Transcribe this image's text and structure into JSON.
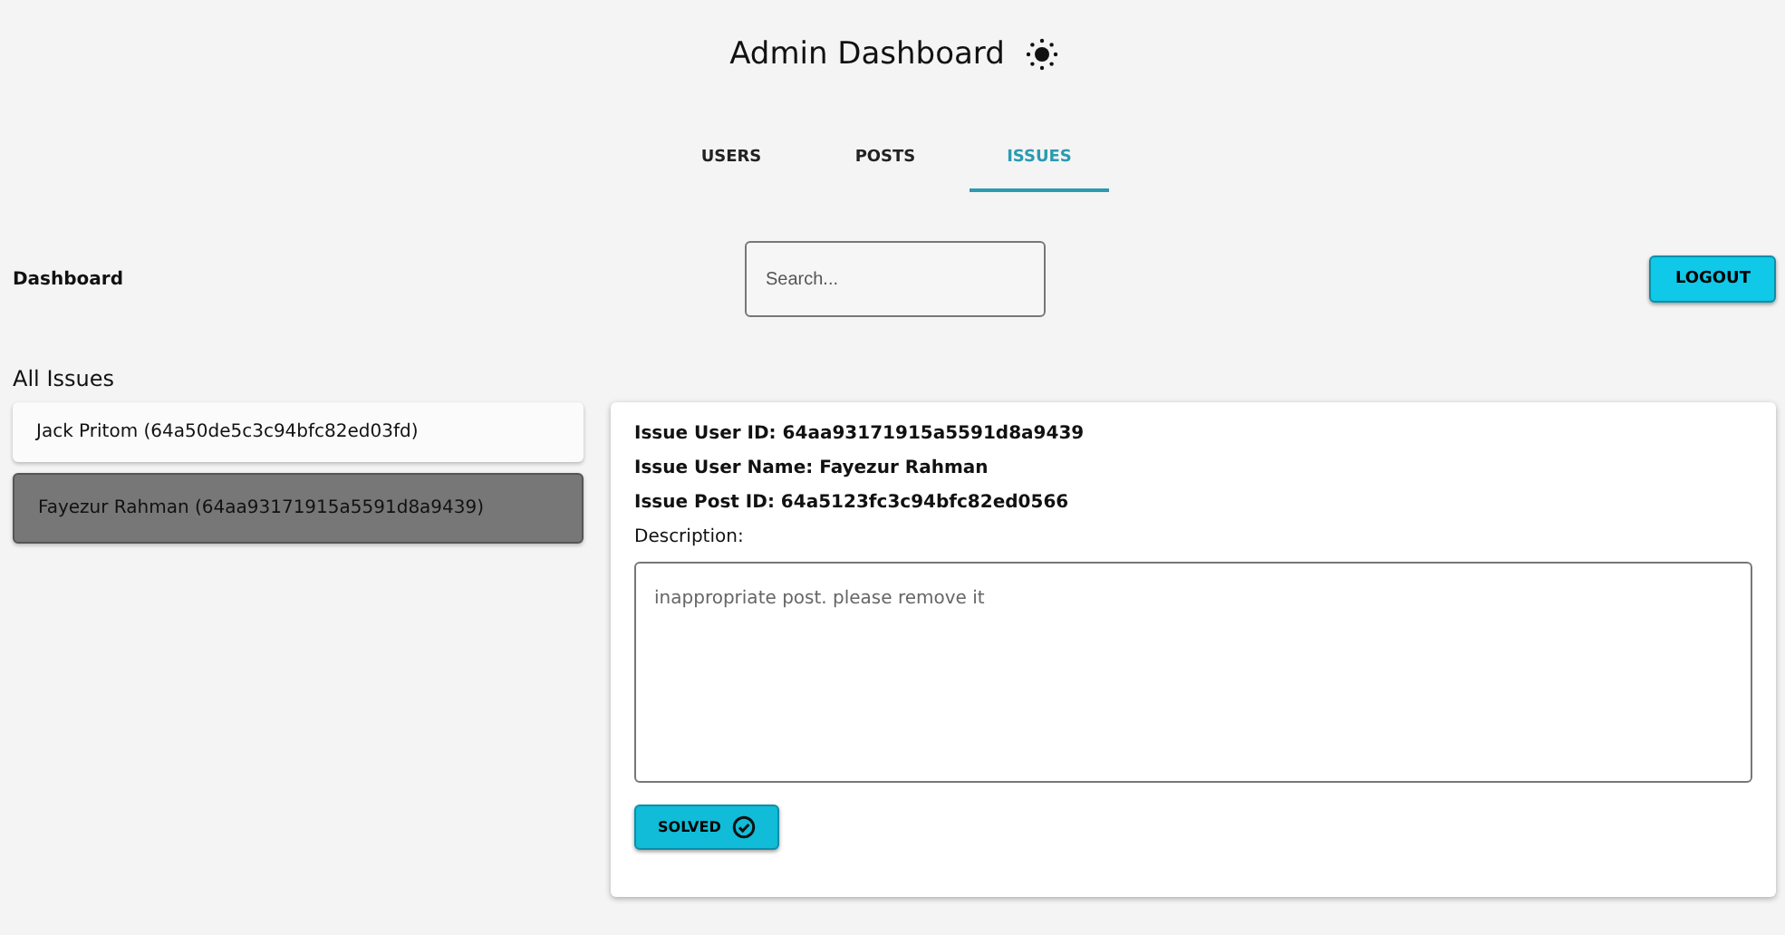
{
  "header": {
    "title": "Admin Dashboard"
  },
  "tabs": [
    {
      "label": "USERS",
      "selected": false
    },
    {
      "label": "POSTS",
      "selected": false
    },
    {
      "label": "ISSUES",
      "selected": true
    }
  ],
  "toolbar": {
    "heading": "Dashboard",
    "search": {
      "placeholder": "Search..."
    },
    "logout": "LOGOUT"
  },
  "issues": {
    "heading": "All Issues",
    "items": [
      {
        "label": "Jack Pritom (64a50de5c3c94bfc82ed03fd)",
        "selected": false
      },
      {
        "label": "Fayezur Rahman (64aa93171915a5591d8a9439)",
        "selected": true
      }
    ]
  },
  "detail": {
    "fields": [
      "Issue User ID: 64aa93171915a5591d8a9439",
      "Issue User Name: Fayezur Rahman",
      "Issue Post ID: 64a5123fc3c94bfc82ed0566"
    ],
    "description_label": "Description:",
    "description": {
      "placeholder": "inappropriate post. please remove it"
    },
    "solved": "SOLVED"
  }
}
